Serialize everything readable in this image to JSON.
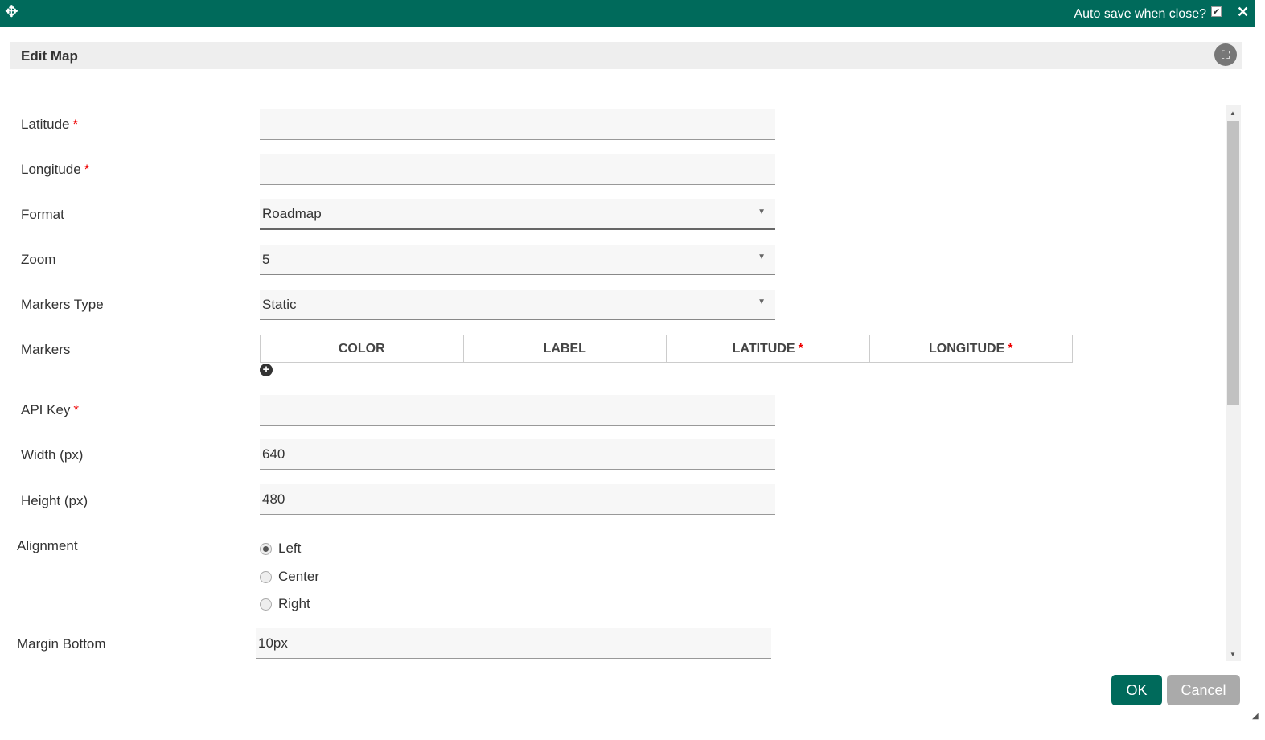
{
  "topbar": {
    "auto_save_label": "Auto save when close?",
    "auto_save_checked": true
  },
  "header": {
    "title": "Edit Map"
  },
  "fields": {
    "latitude": {
      "label": "Latitude",
      "value": ""
    },
    "longitude": {
      "label": "Longitude",
      "value": ""
    },
    "format": {
      "label": "Format",
      "value": "Roadmap"
    },
    "zoom": {
      "label": "Zoom",
      "value": "5"
    },
    "markers_type": {
      "label": "Markers Type",
      "value": "Static"
    },
    "markers": {
      "label": "Markers",
      "columns": [
        "COLOR",
        "LABEL",
        "LATITUDE",
        "LONGITUDE"
      ]
    },
    "api_key": {
      "label": "API Key",
      "value": ""
    },
    "width": {
      "label": "Width (px)",
      "value": "640"
    },
    "height": {
      "label": "Height (px)",
      "value": "480"
    },
    "alignment": {
      "label": "Alignment",
      "options": [
        "Left",
        "Center",
        "Right"
      ],
      "selected": "Left"
    },
    "margin_bottom": {
      "label": "Margin Bottom",
      "value": "10px"
    }
  },
  "required_mark": "*",
  "buttons": {
    "ok": "OK",
    "cancel": "Cancel"
  }
}
